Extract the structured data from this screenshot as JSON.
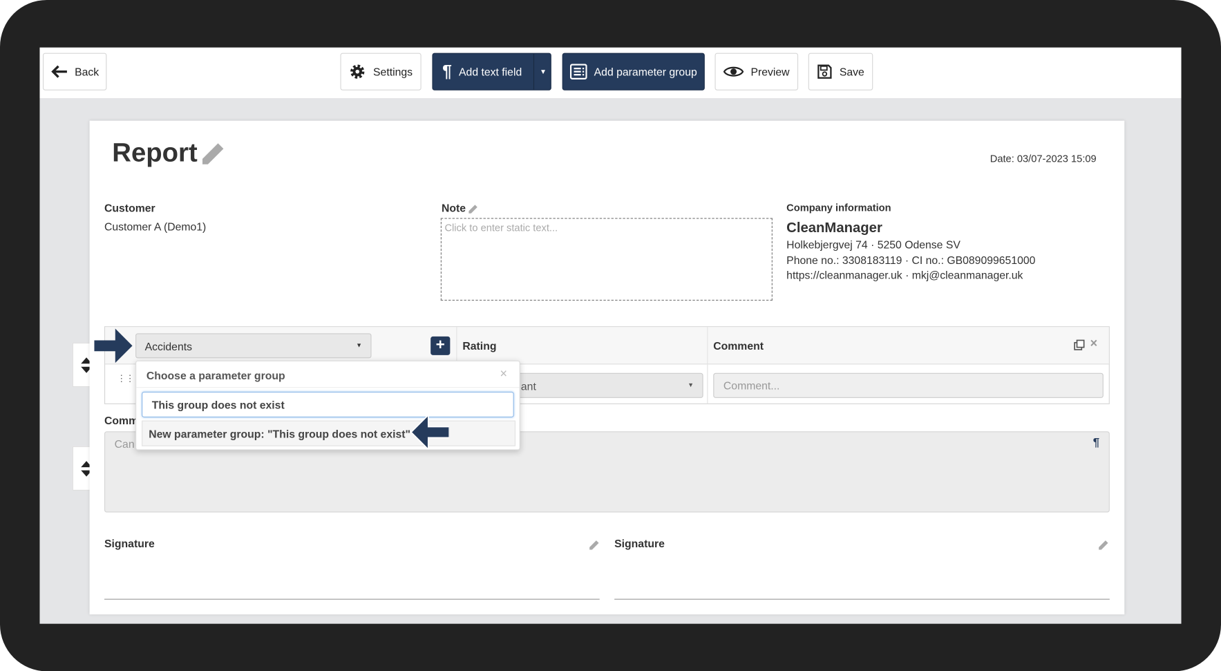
{
  "toolbar": {
    "back": "Back",
    "settings": "Settings",
    "add_text_field": "Add text field",
    "add_parameter_group": "Add parameter group",
    "preview": "Preview",
    "save": "Save"
  },
  "report": {
    "title": "Report",
    "date": "Date: 03/07-2023 15:09"
  },
  "customer": {
    "label": "Customer",
    "value": "Customer A (Demo1)"
  },
  "note": {
    "label": "Note",
    "placeholder": "Click to enter static text..."
  },
  "company": {
    "label": "Company information",
    "name": "CleanManager",
    "address": "Holkebjergvej 74 · 5250 Odense SV",
    "phone": "Phone no.: 3308183119 · CI no.: GB089099651000",
    "web": "https://cleanmanager.uk · mkj@cleanmanager.uk"
  },
  "param_table": {
    "group_select": "Accidents",
    "col_rating": "Rating",
    "col_comment": "Comment",
    "row_rating_partial": "ant",
    "row_comment_placeholder": "Comment..."
  },
  "dropdown": {
    "title": "Choose a parameter group",
    "search_value": "This group does not exist",
    "option": "New parameter group: \"This group does not exist\""
  },
  "comment_field": {
    "label_partial": "Comm",
    "placeholder_partial": "Can"
  },
  "signatures": [
    {
      "label": "Signature"
    },
    {
      "label": "Signature"
    }
  ],
  "colors": {
    "primary": "#253b5c",
    "annotation_arrow": "#253b5c",
    "page_bg": "#e4e5e7"
  }
}
